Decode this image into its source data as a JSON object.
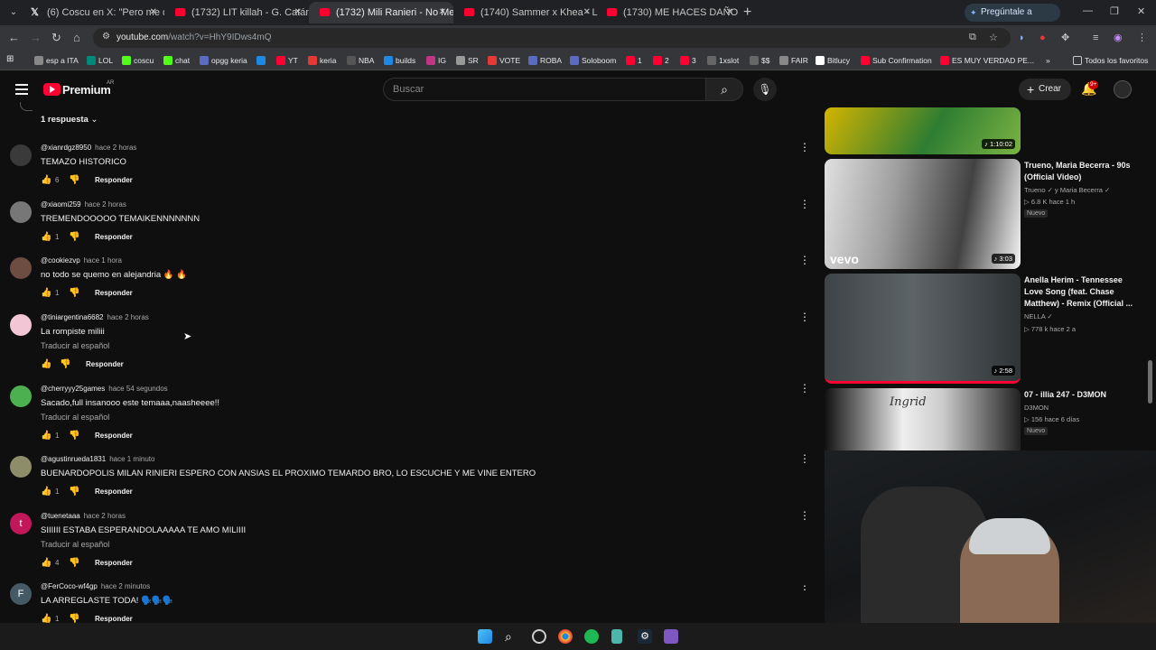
{
  "browser": {
    "tabs": [
      {
        "title": "(6) Coscu en X: \"Pero me queria",
        "icon": "x-icon"
      },
      {
        "title": "(1732) LIT killah - G. Catán (Offi",
        "icon": "youtube-icon"
      },
      {
        "title": "(1732) Mili Ranieri - No Me Qui",
        "icon": "youtube-icon",
        "active": true
      },
      {
        "title": "(1740) Sammer x Khea - LLAMA",
        "icon": "youtube-icon"
      },
      {
        "title": "(1730) ME HACES DAÑO - YouT",
        "icon": "youtube-icon"
      }
    ],
    "gemini_button": "Pregúntale a Gemini",
    "url_host": "youtube.com",
    "url_path": "/watch?v=HhY9IDws4mQ",
    "bookmarks": [
      "esp a ITA",
      "LOL",
      "coscu",
      "chat",
      "opgg keria",
      "",
      "YT",
      "keria",
      "NBA",
      "builds",
      "IG",
      "SR",
      "VOTE",
      "ROBA",
      "Soloboom",
      "1",
      "2",
      "3",
      "1xslot",
      "$$",
      "FAIR",
      "Bitlucy",
      "Sub Confirmation",
      "ES MUY VERDAD PE..."
    ],
    "bookmarks_all": "Todos los favoritos"
  },
  "youtube": {
    "logo_text": "Premium",
    "country": "AR",
    "search_placeholder": "Buscar",
    "create_label": "Crear",
    "notif_count": "9+"
  },
  "comments": {
    "replies_label": "1 respuesta",
    "items": [
      {
        "author": "@xianrdgz8950",
        "time": "hace 2 horas",
        "text": "TEMAZO HISTORICO",
        "likes": "6",
        "reply": "Responder",
        "translate": ""
      },
      {
        "author": "@xiaomi259",
        "time": "hace 2 horas",
        "text": "TREMENDOOOOO TEMAIKENNNNNNN",
        "likes": "1",
        "reply": "Responder",
        "translate": ""
      },
      {
        "author": "@cookiezvp",
        "time": "hace 1 hora",
        "text": "no todo se quemo en alejandria 🔥 🔥",
        "likes": "1",
        "reply": "Responder",
        "translate": ""
      },
      {
        "author": "@tiniargentina6682",
        "time": "hace 2 horas",
        "text": "La rompiste miliii",
        "likes": "",
        "reply": "Responder",
        "translate": "Traducir al español"
      },
      {
        "author": "@cherryyy25games",
        "time": "hace 54 segundos",
        "text": "Sacado,full insanooo este temaaa,naasheeee!!",
        "likes": "1",
        "reply": "Responder",
        "translate": "Traducir al español"
      },
      {
        "author": "@agustinrueda1831",
        "time": "hace 1 minuto",
        "text": "BUENARDOPOLIS MILAN RINIERI ESPERO CON ANSIAS EL PROXIMO TEMARDO BRO, LO ESCUCHE Y ME VINE ENTERO",
        "likes": "1",
        "reply": "Responder",
        "translate": ""
      },
      {
        "author": "@tuenetaaa",
        "time": "hace 2 horas",
        "text": "SIIIIII ESTABA ESPERANDOLAAAAA TE AMO MILIIII",
        "likes": "4",
        "reply": "Responder",
        "translate": "Traducir al español"
      },
      {
        "author": "@FerCoco-wf4gp",
        "time": "hace 2 minutos",
        "text": "LA ARREGLASTE TODA! 🗣️🗣️🗣️",
        "likes": "1",
        "reply": "Responder",
        "translate": ""
      }
    ]
  },
  "related": [
    {
      "title": "",
      "channel": "",
      "views": "",
      "duration": "1:10:02",
      "badge": ""
    },
    {
      "title": "Trueno, Maria Becerra - 90s (Official Video)",
      "channel": "Trueno ✓ y Maria Becerra ✓",
      "views": "▷ 6.8 K  hace 1 h",
      "duration": "3:03",
      "badge": "Nuevo",
      "thumb_text": "vevo"
    },
    {
      "title": "Anella Herim - Tennessee Love Song (feat. Chase Matthew) - Remix (Official ...",
      "channel": "NELLA ✓",
      "views": "▷ 778 k  hace 2 a",
      "duration": "2:58",
      "badge": ""
    },
    {
      "title": "07 - illia 247 - D3MON",
      "channel": "D3MON",
      "views": "▷ 156  hace 6 días",
      "duration": "",
      "badge": "Nuevo",
      "thumb_text": "Ingrid"
    }
  ],
  "colors": {
    "bg": "#0f0f0f",
    "accent": "#ff0033",
    "muted": "#aaaaaa"
  }
}
